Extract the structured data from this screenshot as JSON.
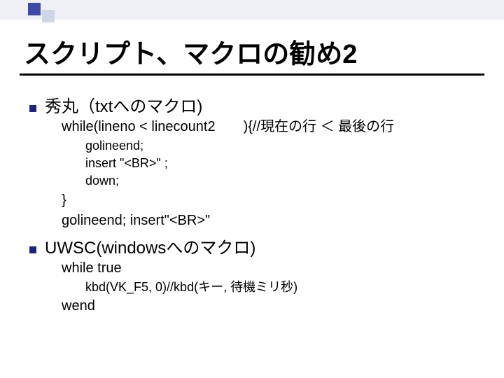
{
  "title": "スクリプト、マクロの勧め2",
  "items": [
    {
      "heading": "秀丸（txtへのマクロ)",
      "lines_l2a": [
        "while(lineno < linecount2　　){//現在の行 ＜ 最後の行"
      ],
      "lines_l3": [
        "golineend;",
        "insert \"<BR>\" ;",
        "down;"
      ],
      "lines_l2b": [
        "}",
        "golineend; insert\"<BR>\""
      ]
    },
    {
      "heading": "UWSC(windowsへのマクロ)",
      "lines_l2a": [
        "while true"
      ],
      "lines_l3": [
        "kbd(VK_F5, 0)//kbd(キー, 待機ミリ秒)"
      ],
      "lines_l2b": [
        "wend"
      ]
    }
  ]
}
